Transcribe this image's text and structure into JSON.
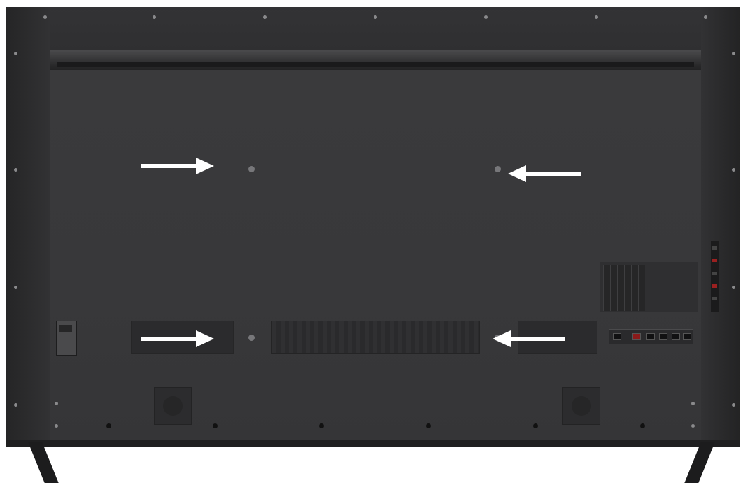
{
  "image": {
    "subject": "tv-back-panel",
    "colors": {
      "body": "#2e2e30",
      "panel": "#38383a",
      "arrow": "#ffffff",
      "mount_hole": "#77777a",
      "port_red": "#8b1a1a"
    },
    "icons": [
      "arrow-right-icon",
      "arrow-left-icon"
    ]
  }
}
